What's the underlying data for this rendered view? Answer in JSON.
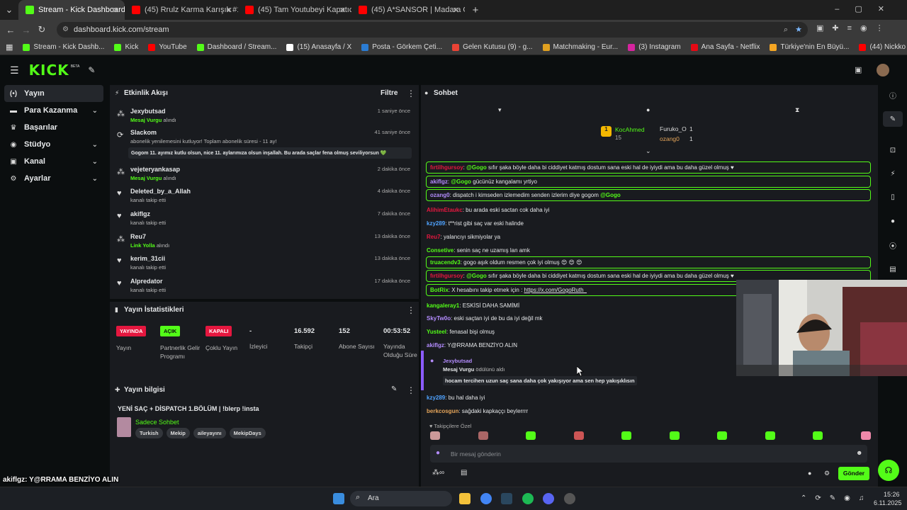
{
  "browser": {
    "tabs": [
      {
        "label": "Stream - Kick Dashboard",
        "active": true,
        "color": "#53fc18"
      },
      {
        "label": "(45) Rrulz Karma Karışık #14 - Y",
        "active": false,
        "color": "#ff0000"
      },
      {
        "label": "(45) Tam Youtubeyi Kapatıcakk",
        "active": false,
        "color": "#ff0000"
      },
      {
        "label": "(45) A*SANSOR | Madara Olduk",
        "active": false,
        "color": "#ff0000"
      }
    ],
    "new_tab": "+",
    "url": "dashboard.kick.com/stream",
    "bookmarks": [
      {
        "label": "Stream - Kick Dashb...",
        "color": "#53fc18"
      },
      {
        "label": "Kick",
        "color": "#53fc18"
      },
      {
        "label": "YouTube",
        "color": "#ff0000"
      },
      {
        "label": "Dashboard / Stream...",
        "color": "#53fc18"
      },
      {
        "label": "(15) Anasayfa / X",
        "color": "#ffffff"
      },
      {
        "label": "Posta - Görkem Çeti...",
        "color": "#2b7cd3"
      },
      {
        "label": "Gelen Kutusu (9) - g...",
        "color": "#ea4335"
      },
      {
        "label": "Matchmaking - Eur...",
        "color": "#e0a020"
      },
      {
        "label": "(3) Instagram",
        "color": "#d6249f"
      },
      {
        "label": "Ana Sayfa - Netflix",
        "color": "#e50914"
      },
      {
        "label": "Türkiye'nin En Büyü...",
        "color": "#f5a623"
      },
      {
        "label": "(44) Nickko Kimiko...",
        "color": "#ff0000"
      }
    ]
  },
  "kick": {
    "logo": "KICK",
    "beta": "BETA",
    "sidebar": [
      {
        "label": "Yayın",
        "icon": "broadcast-icon",
        "active": true,
        "chevron": false
      },
      {
        "label": "Para Kazanma",
        "icon": "money-icon",
        "active": false,
        "chevron": true
      },
      {
        "label": "Başarılar",
        "icon": "trophy-icon",
        "active": false,
        "chevron": false
      },
      {
        "label": "Stüdyo",
        "icon": "studio-icon",
        "active": false,
        "chevron": true
      },
      {
        "label": "Kanal",
        "icon": "channel-icon",
        "active": false,
        "chevron": true
      },
      {
        "label": "Ayarlar",
        "icon": "settings-icon",
        "active": false,
        "chevron": true
      }
    ],
    "activity": {
      "title": "Etkinlik Akışı",
      "filter": "Filtre",
      "items": [
        {
          "name": "Jexybutsad",
          "sub_green": "Mesaj Vurgu",
          "sub": " alındı",
          "time": "1 saniye önce",
          "icon": "points-icon"
        },
        {
          "name": "Slackom",
          "sub_green": "",
          "sub": "abonelik yenilemesini kutluyor! Toplam abonelik süresi - 11 ay!",
          "time": "41 saniye önce",
          "icon": "sub-icon",
          "message": "Gogom 11. ayımız kutlu olsun, nice 11. aylarımıza olsun inşallah. Bu arada saçlar fena olmuş seviliyorsun 💚"
        },
        {
          "name": "vejeteryankasap",
          "sub_green": "Mesaj Vurgu",
          "sub": " alındı",
          "time": "2 dakika önce",
          "icon": "points-icon"
        },
        {
          "name": "Deleted_by_a_Allah",
          "sub_green": "",
          "sub": "kanalı takip etti",
          "time": "4 dakika önce",
          "icon": "heart-icon"
        },
        {
          "name": "akiflgz",
          "sub_green": "",
          "sub": "kanalı takip etti",
          "time": "7 dakika önce",
          "icon": "heart-icon"
        },
        {
          "name": "Reu7",
          "sub_green": "Link Yolla",
          "sub": " alındı",
          "time": "13 dakika önce",
          "icon": "points-icon"
        },
        {
          "name": "kerim_31cii",
          "sub_green": "",
          "sub": "kanalı takip etti",
          "time": "13 dakika önce",
          "icon": "heart-icon"
        },
        {
          "name": "Alpredator",
          "sub_green": "",
          "sub": "kanalı takip etti",
          "time": "17 dakika önce",
          "icon": "heart-icon"
        }
      ]
    },
    "stats": {
      "title": "Yayın İstatistikleri",
      "cols": [
        {
          "badge": "YAYINDA",
          "badge_color": "#e5173f",
          "label": "Yayın"
        },
        {
          "badge": "AÇIK",
          "badge_color": "#53fc18",
          "label": "Partnerlik Gelir Programı"
        },
        {
          "badge": "KAPALI",
          "badge_color": "#e5173f",
          "label": "Çoklu Yayın"
        },
        {
          "value": "-",
          "label": "İzleyici"
        },
        {
          "value": "16.592",
          "label": "Takipçi"
        },
        {
          "value": "152",
          "label": "Abone Sayısı"
        },
        {
          "value": "00:53:52",
          "label": "Yayında Olduğu Süre"
        }
      ]
    },
    "info": {
      "title": "Yayın bilgisi",
      "stream_title": "YENİ SAÇ + DİSPATCH 1.BÖLÜM | !blerp !insta",
      "category": "Sadece Sohbet",
      "tags": [
        "Turkish",
        "Mekip",
        "aileyayını",
        "MekipDays"
      ]
    },
    "chat": {
      "title": "Sohbet",
      "pinned_top": {
        "name": "KocAhmed",
        "rank": "1",
        "count": "15"
      },
      "pinned_others": [
        {
          "name": "Furuko_O",
          "count": "1"
        },
        {
          "name": "ozang0",
          "count": "1"
        }
      ],
      "messages": [
        {
          "user": "fırtilhgursoy",
          "color": "#e5173f",
          "highlight": true,
          "mention": "@Gogo",
          "text": " sıfır şaka böyle daha bi ciddiyet katmış dostum sana eski hal de iyiydi ama bu daha güzel olmuş ♥"
        },
        {
          "user": "akiflgz",
          "color": "#b48cff",
          "highlight": true,
          "mention": "@Gogo",
          "text": " gücünüz kangalamı yrtiyo"
        },
        {
          "user": "ozang0",
          "color": "#b48cff",
          "highlight": true,
          "mention": "",
          "text": "dispatch i kimseden izlemedim senden izlerim diye gogom ",
          "mention2": "@Gogo"
        },
        {
          "user": "AlihimEtaukc",
          "color": "#e5173f",
          "highlight": false,
          "mention": "",
          "text": "bu arada eski sactan cok daha iyi"
        },
        {
          "user": "kzy289",
          "color": "#4fa3ff",
          "highlight": false,
          "mention": "",
          "text": "t**rist gibi saç var eski halinde"
        },
        {
          "user": "Reu7",
          "color": "#e5173f",
          "highlight": false,
          "mention": "",
          "text": "yalancıyı sikmiyolar ya"
        },
        {
          "user": "Consetive",
          "color": "#53fc18",
          "highlight": false,
          "mention": "",
          "text": "senin saç ne uzamış lan amk"
        },
        {
          "user": "truacendv3",
          "color": "#53fc18",
          "highlight": true,
          "mention": "",
          "text": "gogo aşık oldum resmen çok iyi olmuş 😍 😍 😍"
        },
        {
          "user": "fırtilhgursoy",
          "color": "#e5173f",
          "highlight": true,
          "mention": "@Gogo",
          "text": " sıfır şaka böyle daha bi ciddiyet katmış dostum sana eski hal de iyiydi ama bu daha güzel olmuş ♥"
        },
        {
          "user": "BotRix",
          "color": "#53fc18",
          "highlight": true,
          "mention": "",
          "text": "X hesabını takip etmek için : ",
          "link": "https://x.com/GogoRuth_"
        },
        {
          "user": "kangaleray1",
          "color": "#53fc18",
          "highlight": false,
          "mention": "",
          "text": "ESKİSİ DAHA SAMİMİ"
        },
        {
          "user": "SkyTw0o",
          "color": "#b48cff",
          "highlight": false,
          "mention": "",
          "text": "eski saçtan iyi de bu da iyi değil mk"
        },
        {
          "user": "Yusteel",
          "color": "#53fc18",
          "highlight": false,
          "mention": "",
          "text": "fenasal bişi olmuş"
        },
        {
          "user": "akiflgz",
          "color": "#b48cff",
          "highlight": false,
          "mention": "",
          "text": "Y@RRAMA BENZİYO ALIN"
        }
      ],
      "redeem": {
        "user": "Jexybutsad",
        "reward": "Mesaj Vurgu",
        "reward_sub": " ödülünü aldı",
        "text": "hocam tercihen uzun saç sana daha çok yakışıyor ama sen hep yakışıklısın"
      },
      "after": [
        {
          "user": "kzy289",
          "color": "#4fa3ff",
          "text": "bu hal daha iyi"
        },
        {
          "user": "berkcosgun",
          "color": "#e5a55a",
          "text": "sağdaki kapkaççı beylerrrr"
        }
      ],
      "emote_header": "Takipçilere Özel",
      "input_placeholder": "Bir mesaj gönderin",
      "send": "Gönder"
    }
  },
  "overlay_chat": [
    {
      "user": "akiflgz",
      "text": "Y@RRAMA BENZİYO ALIN"
    },
    {
      "user": "kzy289",
      "text": "bu hal daha iyi"
    },
    {
      "user": "berkcosgun",
      "text": "sağdaki kapkaççı beylerrrr"
    }
  ],
  "taskbar": {
    "search": "Ara",
    "time": "15:26",
    "date": "6.11.2025"
  }
}
